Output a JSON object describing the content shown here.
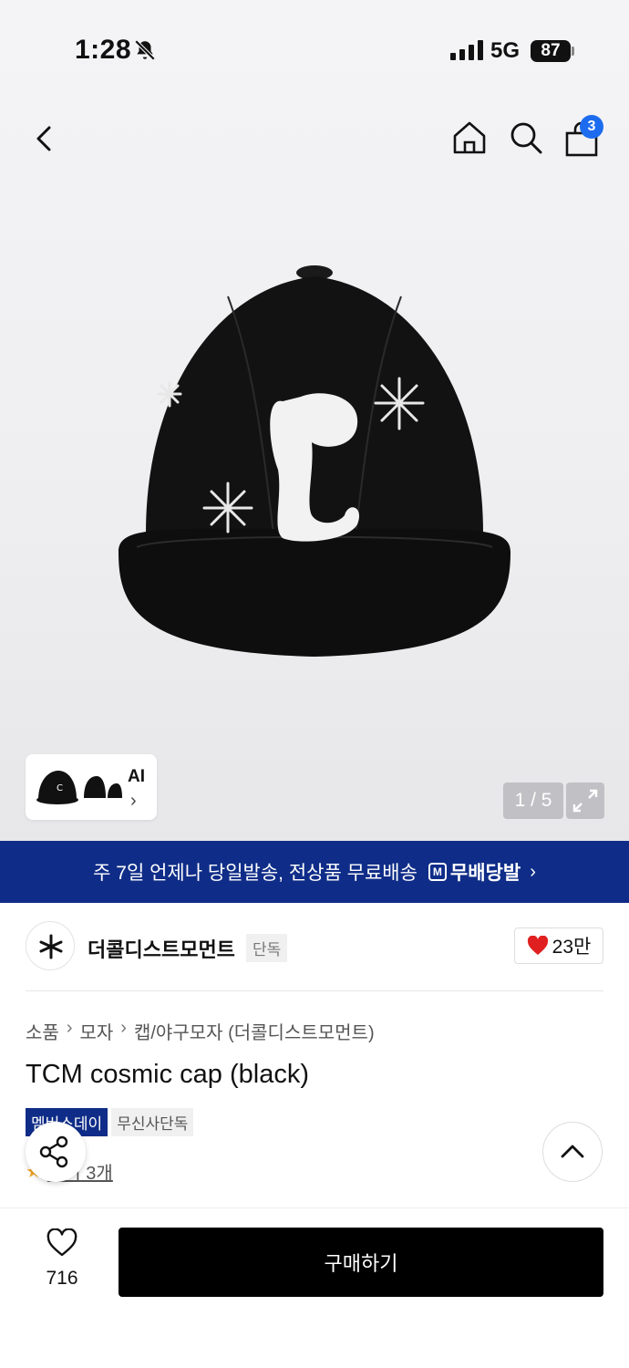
{
  "status_bar": {
    "time": "1:28",
    "network": "5G",
    "battery": "87"
  },
  "header": {
    "cart_count": "3"
  },
  "gallery": {
    "thumb_label": "AI",
    "counter": "1 / 5"
  },
  "banner": {
    "text": "주 7일 언제나 당일발송, 전상품 무료배송",
    "logo_text": "무배당발"
  },
  "brand": {
    "name": "더콜디스트모먼트",
    "exclusive_tag": "단독",
    "likes": "23만"
  },
  "breadcrumb": [
    "소품",
    "모자",
    "캡/야구모자 (더콜디스트모먼트)"
  ],
  "product": {
    "title": "TCM cosmic cap (black)",
    "tags": [
      "멤버스데이",
      "무신사단독"
    ],
    "review_text": "후기 3개"
  },
  "bottom_bar": {
    "wish_count": "716",
    "buy_label": "구매하기"
  },
  "colors": {
    "accent": "#0f2d88",
    "badge": "#1d6cf0",
    "heart": "#e02020"
  },
  "icons": [
    "bell-slash-icon",
    "back-icon",
    "home-icon",
    "search-icon",
    "bag-icon",
    "expand-icon",
    "share-icon",
    "chevron-up-icon",
    "heart-icon"
  ]
}
